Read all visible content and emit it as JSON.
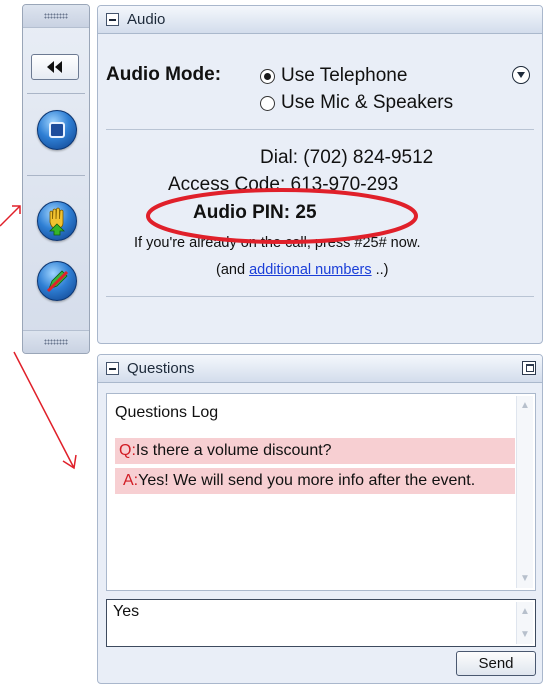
{
  "colors": {
    "accent_red": "#e0202a",
    "question_bg": "#f7cfd2",
    "link": "#1a3ed8",
    "panel_bg": "#e9eef7"
  },
  "toolbar": {
    "collapse_icon": "double-left-arrow-icon",
    "buttons": [
      {
        "icon": "stop-icon"
      },
      {
        "icon": "raise-hand-icon"
      },
      {
        "icon": "pen-off-icon"
      }
    ]
  },
  "audio": {
    "title": "Audio",
    "mode_label": "Audio Mode:",
    "options": [
      {
        "label": "Use Telephone",
        "selected": true
      },
      {
        "label": "Use Mic & Speakers",
        "selected": false
      }
    ],
    "dial_label": "Dial:",
    "dial_number": "(702) 824-9512",
    "access_label": "Access Code:",
    "access_code": "613-970-293",
    "pin_label": "Audio PIN:",
    "pin_value": "25",
    "note": "If you're already on the call, press #25# now.",
    "additional_prefix": "(and",
    "additional_link": "additional numbers",
    "additional_suffix": "..)"
  },
  "questions": {
    "title": "Questions",
    "log_title": "Questions Log",
    "items": [
      {
        "prefix": "Q:",
        "text": "Is there a volume discount?"
      },
      {
        "prefix": "A:",
        "text": "Yes! We will send you more info after the event."
      }
    ],
    "input_value": "Yes",
    "send_label": "Send"
  }
}
